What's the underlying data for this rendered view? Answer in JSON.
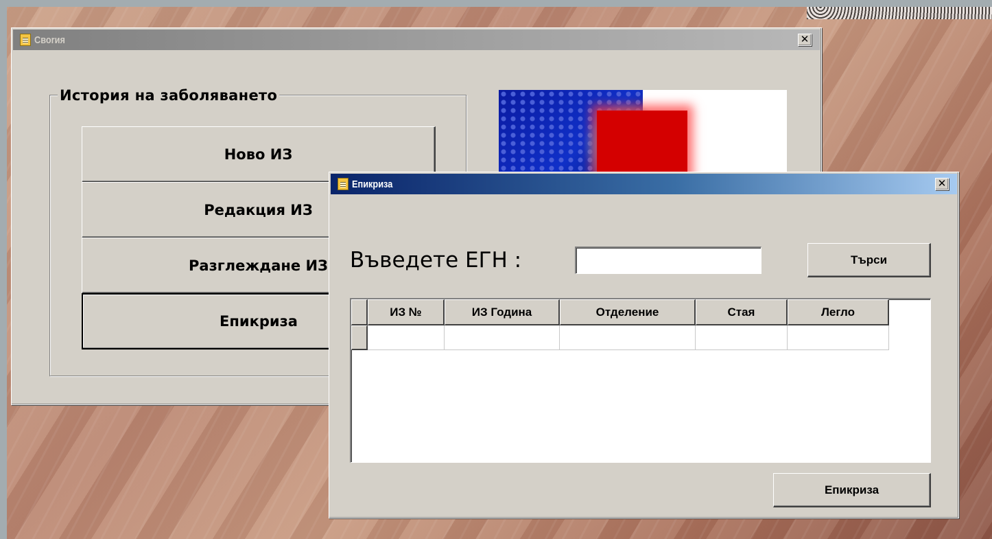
{
  "main_window": {
    "title": "Своrия",
    "close_glyph": "✕",
    "group_label": "История на заболяването",
    "buttons": [
      {
        "label": "Ново ИЗ"
      },
      {
        "label": "Редакция ИЗ"
      },
      {
        "label": "Разглеждане ИЗ"
      },
      {
        "label": "Епикриза"
      }
    ]
  },
  "dialog": {
    "title": "Епикриза",
    "close_glyph": "✕",
    "egn_label": "Въведете ЕГН :",
    "egn_value": "",
    "search_button": "Търси",
    "grid": {
      "columns": [
        "ИЗ №",
        "ИЗ Година",
        "Отделение",
        "Стая",
        "Легло"
      ],
      "rows": [
        [
          "",
          "",
          "",
          "",
          ""
        ]
      ]
    },
    "action_button": "Епикриза"
  },
  "colors": {
    "dialog_titlebar_start": "#0a246a",
    "dialog_titlebar_end": "#a6caf0",
    "inactive_titlebar_start": "#808080",
    "window_face": "#d4d0c8"
  }
}
